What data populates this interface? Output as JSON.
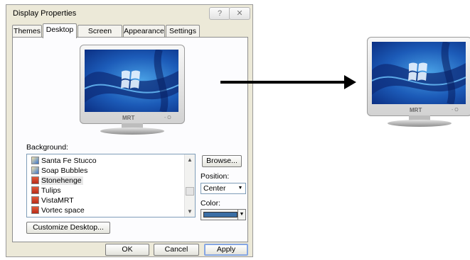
{
  "dialog": {
    "title": "Display Properties",
    "help_glyph": "?",
    "close_glyph": "✕",
    "tabs": [
      {
        "label": "Themes"
      },
      {
        "label": "Desktop",
        "active": true
      },
      {
        "label": "Screen Saver"
      },
      {
        "label": "Appearance"
      },
      {
        "label": "Settings"
      }
    ],
    "monitor_brand": "MRT",
    "monitor_power_glyph": "- O",
    "background_label": "Background:",
    "backgrounds": [
      {
        "label": "Santa Fe Stucco",
        "icon": "picture-icon"
      },
      {
        "label": "Soap Bubbles",
        "icon": "picture-icon"
      },
      {
        "label": "Stonehenge",
        "icon": "bitmap-icon",
        "selected": true
      },
      {
        "label": "Tulips",
        "icon": "bitmap-icon"
      },
      {
        "label": "VistaMRT",
        "icon": "bitmap-icon"
      },
      {
        "label": "Vortec space",
        "icon": "bitmap-icon"
      }
    ],
    "scroll_up_glyph": "▲",
    "scroll_down_glyph": "▼",
    "browse_label": "Browse...",
    "position_label": "Position:",
    "position_value": "Center",
    "dropdown_glyph": "▼",
    "color_label": "Color:",
    "color_value": "#3a6ea5",
    "customize_label": "Customize Desktop...",
    "ok_label": "OK",
    "cancel_label": "Cancel",
    "apply_label": "Apply"
  },
  "preview": {
    "monitor_brand": "MRT",
    "monitor_power_glyph": "- O"
  }
}
